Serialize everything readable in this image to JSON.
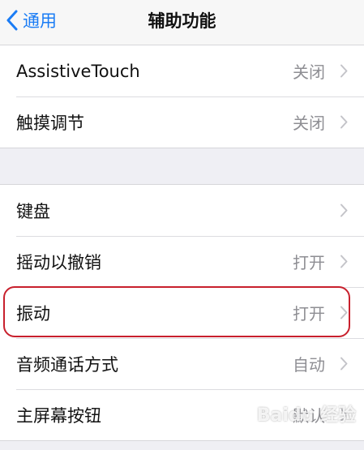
{
  "navbar": {
    "back_label": "通用",
    "title": "辅助功能"
  },
  "group1": [
    {
      "label": "AssistiveTouch",
      "value": "关闭"
    },
    {
      "label": "触摸调节",
      "value": "关闭"
    }
  ],
  "group2": [
    {
      "label": "键盘",
      "value": ""
    },
    {
      "label": "摇动以撤销",
      "value": "打开"
    },
    {
      "label": "振动",
      "value": "打开"
    },
    {
      "label": "音频通话方式",
      "value": "自动"
    },
    {
      "label": "主屏幕按钮",
      "value": "默认"
    }
  ],
  "watermark": "Baidu 经验",
  "colors": {
    "accent": "#1a7cf5",
    "highlight": "#c8202d",
    "secondary_text": "#8e8e93"
  }
}
